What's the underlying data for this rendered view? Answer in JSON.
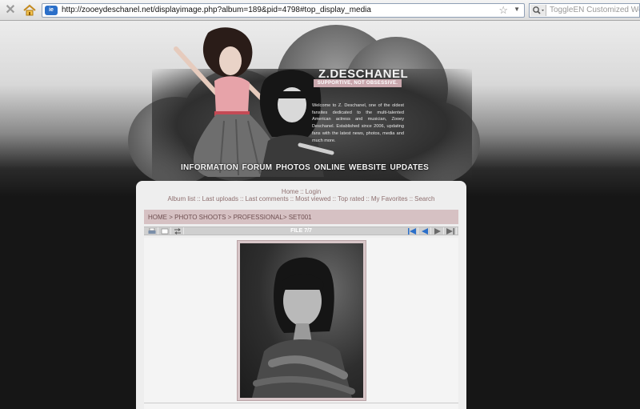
{
  "browser": {
    "url": "http://zooeydeschanel.net/displayimage.php?album=189&pid=4798#top_display_media",
    "search_placeholder": "ToggleEN Customized Web Search",
    "icons": [
      "stop-icon",
      "home-icon",
      "site-favicon",
      "bookmark-star-icon",
      "dropdown-icon",
      "search-engine-icon"
    ]
  },
  "banner": {
    "title": "Z.DESCHANEL",
    "tagline": "SUPPORTIVE, NOT OBSESSIVE.",
    "welcome": "Welcome to Z. Deschanel, one of the oldest fansites dedicated to the multi-talented American actress and musician, Zooey Deschanel. Established since 2006, updating fans with the latest news, photos, media and much more.",
    "nav": [
      "INFORMATION",
      "FORUM",
      "PHOTOS",
      "ONLINE",
      "WEBSITE",
      "UPDATES"
    ]
  },
  "gallery": {
    "top_links": [
      "Home",
      "Login"
    ],
    "links": [
      "Album list",
      "Last uploads",
      "Last comments",
      "Most viewed",
      "Top rated",
      "My Favorites",
      "Search"
    ],
    "breadcrumb": [
      "HOME",
      "PHOTO SHOOTS",
      "PROFESSIONAL",
      "SET001"
    ],
    "file_label": "FILE 7/7",
    "left_controls": [
      "print-icon",
      "comment-icon",
      "slideshow-icon"
    ],
    "right_controls": [
      "first-icon",
      "previous-icon",
      "next-icon",
      "last-icon"
    ]
  },
  "colors": {
    "link": "#8e6f6f",
    "breadcrumb_bar": "#d6c1c3",
    "nav_arrow_blue": "#2b6fc9",
    "tagline_bg": "#c9a7ad"
  }
}
